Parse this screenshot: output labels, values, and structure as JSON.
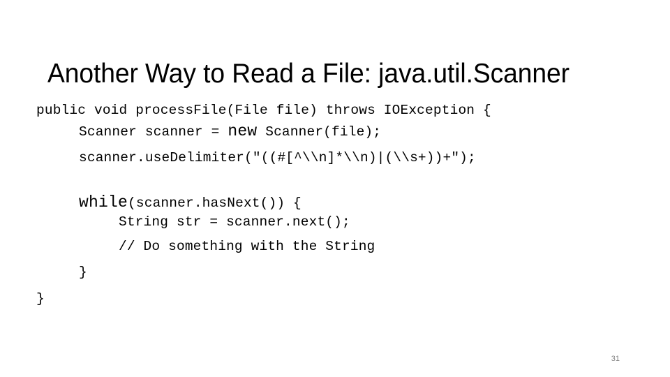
{
  "slide": {
    "title": "Another Way to Read a File: java.util.Scanner",
    "page_number": "31",
    "background_color": "#ffffff",
    "text_color": "#000000",
    "page_number_color": "#808080"
  },
  "code": {
    "language": "java",
    "lines": [
      {
        "indent": 0,
        "text": "public void processFile(File file) throws IOException {",
        "segments": [
          {
            "text": "public void processFile(File file) throws IOException {",
            "emphasis": false
          }
        ]
      },
      {
        "indent": 1,
        "text": "Scanner scanner = new Scanner(file);",
        "segments": [
          {
            "text": "Scanner scanner = ",
            "emphasis": false
          },
          {
            "text": "new",
            "emphasis": true
          },
          {
            "text": " Scanner(file);",
            "emphasis": false
          }
        ]
      },
      {
        "indent": 1,
        "text": "scanner.useDelimiter(\"((#[^\\\\n]*\\\\n)|(\\\\s+))+\");",
        "segments": [
          {
            "text": "scanner.useDelimiter(\"((#[^\\\\n]*\\\\n)|(\\\\s+))+\");",
            "emphasis": false
          }
        ]
      },
      {
        "indent": 1,
        "text": "while(scanner.hasNext()) {",
        "segments": [
          {
            "text": "while",
            "emphasis": true
          },
          {
            "text": "(scanner.hasNext()) {",
            "emphasis": false
          }
        ]
      },
      {
        "indent": 2,
        "text": "String str = scanner.next();",
        "segments": [
          {
            "text": "String str = scanner.next();",
            "emphasis": false
          }
        ]
      },
      {
        "indent": 2,
        "text": "// Do something with the String",
        "segments": [
          {
            "text": "// Do something with the String",
            "emphasis": false
          }
        ]
      },
      {
        "indent": 1,
        "text": "}",
        "segments": [
          {
            "text": "}",
            "emphasis": false
          }
        ]
      },
      {
        "indent": 0,
        "text": "}",
        "segments": [
          {
            "text": "}",
            "emphasis": false
          }
        ]
      }
    ]
  }
}
